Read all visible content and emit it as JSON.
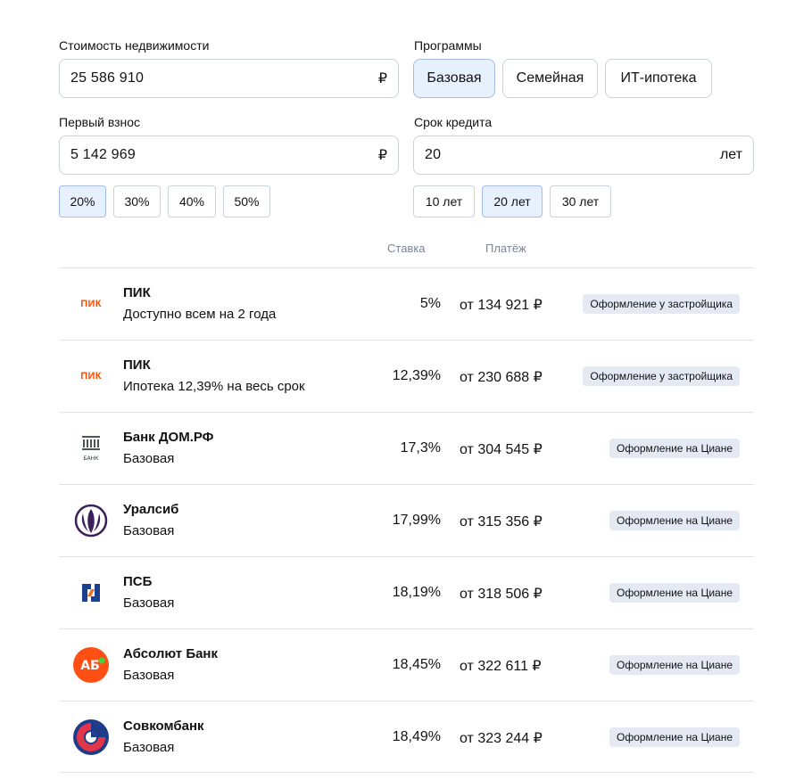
{
  "form": {
    "price_label": "Стоимость недвижимости",
    "price_value": "25 586 910",
    "price_unit": "₽",
    "down_label": "Первый взнос",
    "down_value": "5 142 969",
    "down_unit": "₽",
    "down_chips": [
      {
        "label": "20%",
        "active": true
      },
      {
        "label": "30%",
        "active": false
      },
      {
        "label": "40%",
        "active": false
      },
      {
        "label": "50%",
        "active": false
      }
    ],
    "programs_label": "Программы",
    "programs": [
      {
        "label": "Базовая",
        "active": true
      },
      {
        "label": "Семейная",
        "active": false
      },
      {
        "label": "ИТ-ипотека",
        "active": false
      }
    ],
    "term_label": "Срок кредита",
    "term_value": "20",
    "term_unit": "лет",
    "term_chips": [
      {
        "label": "10 лет",
        "active": false
      },
      {
        "label": "20 лет",
        "active": true
      },
      {
        "label": "30 лет",
        "active": false
      }
    ]
  },
  "table": {
    "rate_header": "Ставка",
    "payment_header": "Платёж",
    "rows": [
      {
        "logo": "pik-logo-icon",
        "name": "ПИК",
        "sub": "Доступно всем на 2 года",
        "rate": "5%",
        "payment": "от 134 921 ₽",
        "tag": "Оформление у застройщика"
      },
      {
        "logo": "pik-logo-icon",
        "name": "ПИК",
        "sub": "Ипотека 12,39% на весь срок",
        "rate": "12,39%",
        "payment": "от 230 688 ₽",
        "tag": "Оформление у застройщика"
      },
      {
        "logo": "domrf-logo-icon",
        "name": "Банк ДОМ.РФ",
        "sub": "Базовая",
        "rate": "17,3%",
        "payment": "от 304 545 ₽",
        "tag": "Оформление на Циане"
      },
      {
        "logo": "uralsib-logo-icon",
        "name": "Уралсиб",
        "sub": "Базовая",
        "rate": "17,99%",
        "payment": "от 315 356 ₽",
        "tag": "Оформление на Циане"
      },
      {
        "logo": "psb-logo-icon",
        "name": "ПСБ",
        "sub": "Базовая",
        "rate": "18,19%",
        "payment": "от 318 506 ₽",
        "tag": "Оформление на Циане"
      },
      {
        "logo": "absolut-logo-icon",
        "name": "Абсолют Банк",
        "sub": "Базовая",
        "rate": "18,45%",
        "payment": "от 322 611 ₽",
        "tag": "Оформление на Циане"
      },
      {
        "logo": "sovcombank-logo-icon",
        "name": "Совкомбанк",
        "sub": "Базовая",
        "rate": "18,49%",
        "payment": "от 323 244 ₽",
        "tag": "Оформление на Циане"
      }
    ]
  },
  "logo_text": {
    "pik": "ПИК",
    "domrf_top": "ДОМ",
    "domrf_bottom": "БАНК",
    "absolut": "АБ"
  },
  "colors": {
    "accent_bg": "#e7f0fd",
    "border": "#c9d1dd",
    "tag_bg": "#e4e9f4",
    "pik_orange": "#fc4c02",
    "uralsib_purple": "#3b1e5a",
    "psb_blue": "#1d3f8f",
    "psb_orange": "#f26c21",
    "absolut_orange": "#ff4f12",
    "sovcombank_red": "#e3354a",
    "sovcombank_blue": "#1f3c88"
  }
}
